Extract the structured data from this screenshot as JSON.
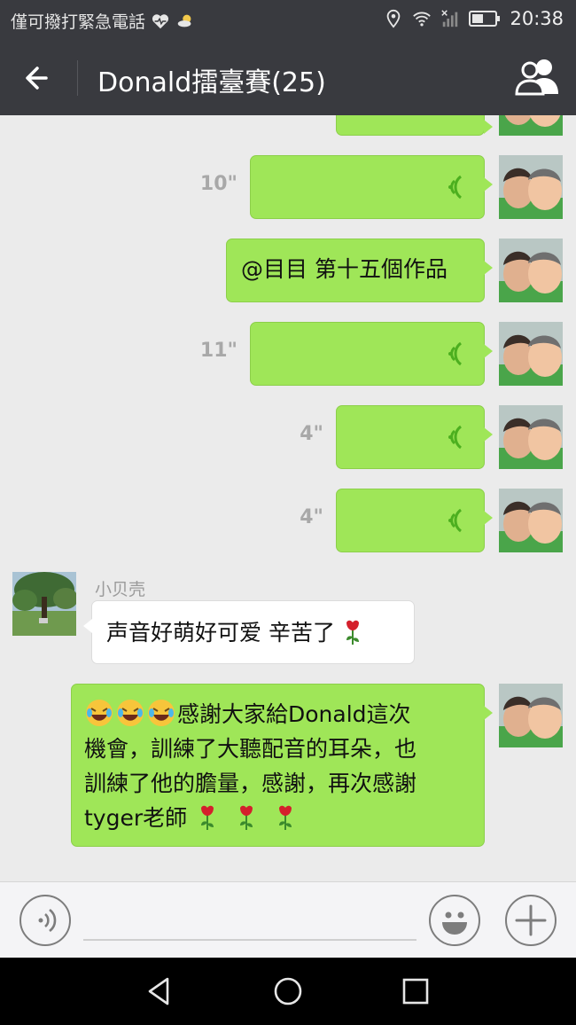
{
  "status_bar": {
    "carrier_text": "僅可撥打緊急電話",
    "time": "20:38"
  },
  "header": {
    "title": "Donald擂臺賽(25)"
  },
  "messages": [
    {
      "type": "voice",
      "side": "right",
      "duration": ""
    },
    {
      "type": "voice",
      "side": "right",
      "duration": "10\""
    },
    {
      "type": "text",
      "side": "right",
      "text": "@目目 第十五個作品"
    },
    {
      "type": "voice",
      "side": "right",
      "duration": "11\""
    },
    {
      "type": "voice",
      "side": "right",
      "duration": "4\""
    },
    {
      "type": "voice",
      "side": "right",
      "duration": "4\""
    },
    {
      "type": "text",
      "side": "left",
      "sender": "小贝壳",
      "text": "声音好萌好可爱 辛苦了"
    },
    {
      "type": "text",
      "side": "right",
      "lines": [
        "感謝大家給Donald這次",
        "機會，訓練了大聽配音的耳朵，也",
        "訓練了他的膽量，感謝，再次感謝",
        "tyger老師"
      ]
    }
  ],
  "input": {
    "placeholder": ""
  },
  "colors": {
    "header_bg": "#393a3f",
    "chat_bg": "#ebebeb",
    "bubble_green": "#9fe658",
    "voice_icon": "#4caf1f"
  },
  "icons": {
    "back": "back-arrow-icon",
    "group": "group-people-icon",
    "voice_toggle": "voice-toggle-icon",
    "emoji": "emoji-icon",
    "add": "add-icon"
  }
}
